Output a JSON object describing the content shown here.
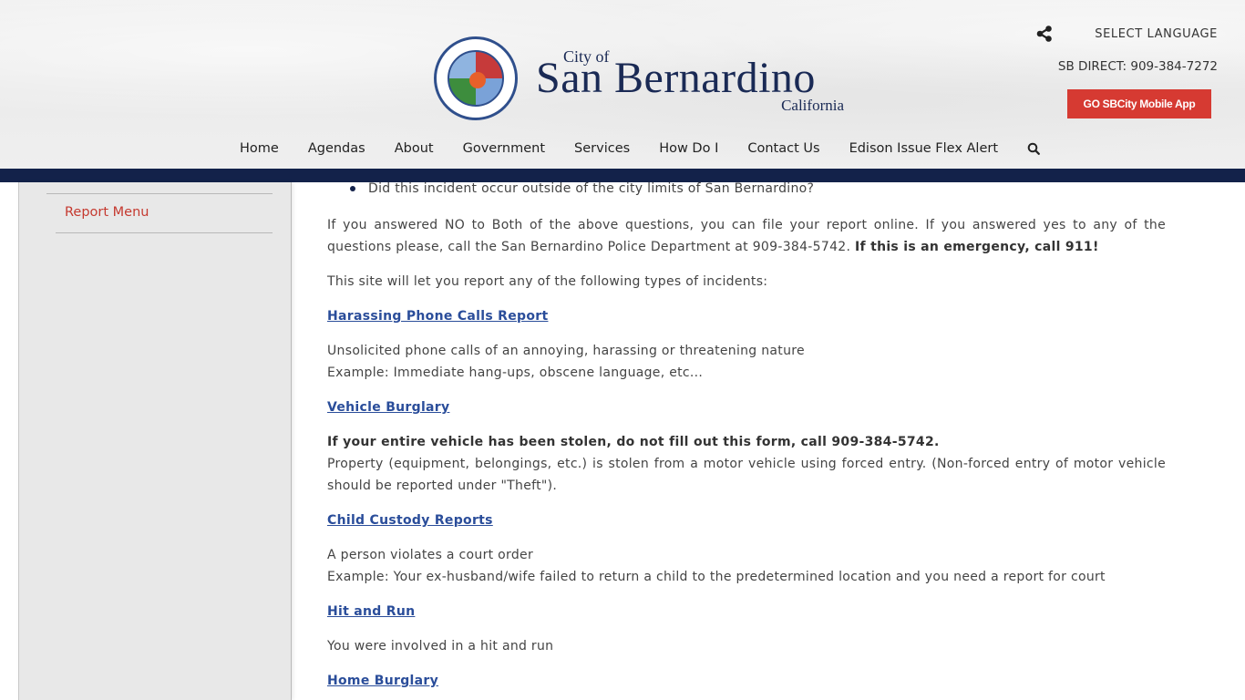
{
  "header": {
    "seal_alt": "City of San Bernardino California seal - Founded in 1810",
    "city_of": "City of",
    "city_name": "San Bernardino",
    "state": "California",
    "select_language": "SELECT LANGUAGE",
    "sb_direct": "SB DIRECT: 909-384-7272",
    "app_button": "GO SBCity Mobile App",
    "colors": {
      "navy": "#13224a",
      "app_button": "#d63a32",
      "link": "#2a4d9a",
      "sidebar_link": "#c5392f"
    }
  },
  "nav": {
    "items": [
      {
        "label": "Home"
      },
      {
        "label": "Agendas"
      },
      {
        "label": "About"
      },
      {
        "label": "Government"
      },
      {
        "label": "Services"
      },
      {
        "label": "How Do I"
      },
      {
        "label": "Contact Us"
      },
      {
        "label": "Edison Issue Flex Alert"
      }
    ],
    "search_icon": "search-icon"
  },
  "sidebar": {
    "items": [
      {
        "label": "Report Menu"
      }
    ]
  },
  "content": {
    "bullet": "Did this incident occur outside of the city limits of San Bernardino?",
    "intro_para": "If you answered NO to Both of the above questions, you can file your report online. If you answered yes to any of the questions please, call the San Bernardino Police Department at 909-384-5742. ",
    "intro_emergency": "If this is an emergency, call 911!",
    "types_intro": "This site will let you report any of the following types of incidents:",
    "reports": [
      {
        "title": "Harassing Phone Calls Report",
        "lines": [
          "Unsolicited phone calls of an annoying, harassing or threatening nature",
          "Example: Immediate hang-ups, obscene language, etc..."
        ]
      },
      {
        "title": "Vehicle Burglary",
        "warning": "If your entire vehicle has been stolen, do not fill out this form, call 909-384-5742.",
        "lines": [
          "Property (equipment, belongings, etc.) is stolen from a motor vehicle using forced entry. (Non-forced entry of motor vehicle should be reported under \"Theft\")."
        ]
      },
      {
        "title": "Child Custody Reports",
        "lines": [
          "A person violates a court order",
          "Example: Your ex-husband/wife failed to return a child to the predetermined location and you need a report for court"
        ]
      },
      {
        "title": "Hit and Run",
        "lines": [
          "You were involved in a hit and run"
        ]
      },
      {
        "title": "Home Burglary"
      }
    ]
  }
}
